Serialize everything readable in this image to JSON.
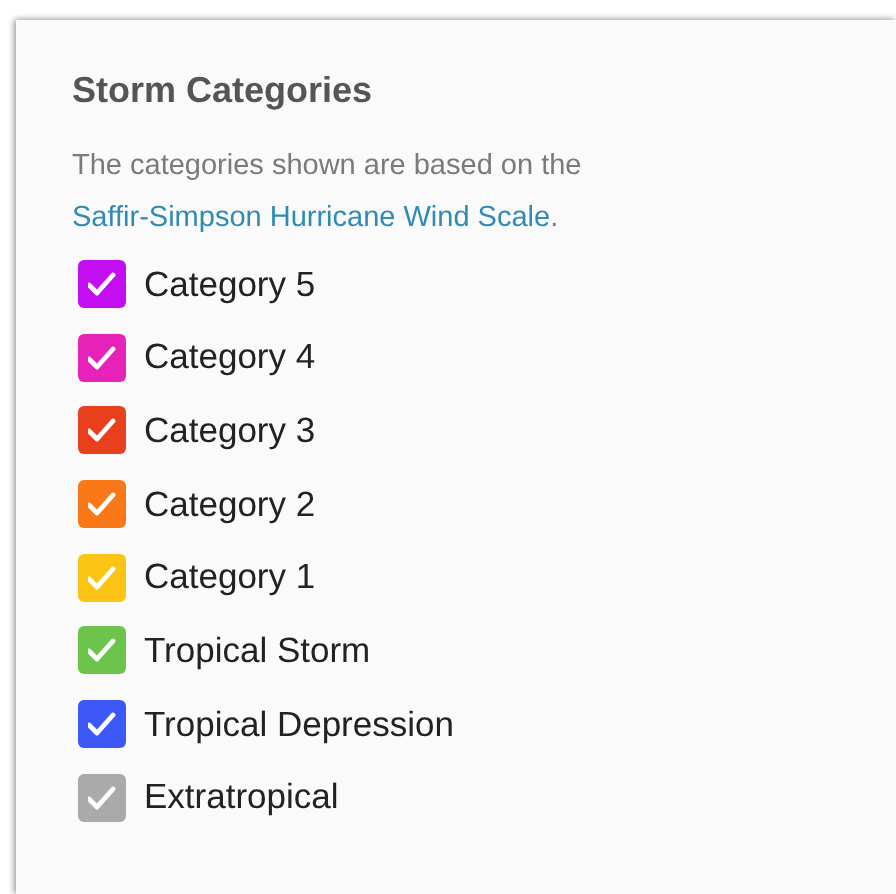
{
  "panel": {
    "title": "Storm Categories",
    "description": {
      "text": "The categories shown are based on the",
      "link": "Saffir-Simpson Hurricane Wind Scale",
      "after": "."
    },
    "categories": [
      {
        "label": "Category 5",
        "checked": true,
        "color": "#c20ef0"
      },
      {
        "label": "Category 4",
        "checked": true,
        "color": "#e622b8"
      },
      {
        "label": "Category 3",
        "checked": true,
        "color": "#e8401c"
      },
      {
        "label": "Category 2",
        "checked": true,
        "color": "#fb7818"
      },
      {
        "label": "Category 1",
        "checked": true,
        "color": "#fcc516"
      },
      {
        "label": "Tropical Storm",
        "checked": true,
        "color": "#6cc54a"
      },
      {
        "label": "Tropical Depression",
        "checked": true,
        "color": "#3c58f6"
      },
      {
        "label": "Extratropical",
        "checked": true,
        "color": "#aaaaaa"
      }
    ]
  }
}
